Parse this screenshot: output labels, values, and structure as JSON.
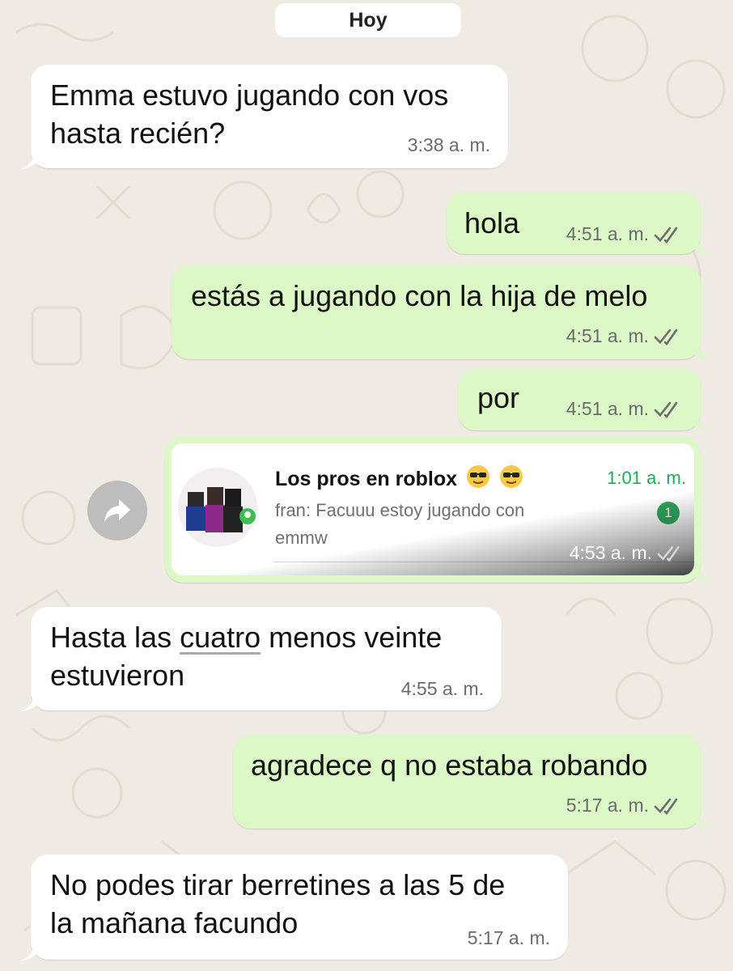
{
  "date_separator": "Hoy",
  "messages": [
    {
      "text": "Emma estuvo jugando con vos\nhasta recién?",
      "time": "3:38 a. m."
    },
    {
      "text": "hola",
      "time": "4:51 a. m."
    },
    {
      "text": "estás a jugando con la hija de melo",
      "time": "4:51 a. m."
    },
    {
      "text": "por",
      "time": "4:51 a. m."
    },
    {
      "text_before": "Hasta las ",
      "text_underlined": "cuatro",
      "text_after": " menos veinte\nestuvieron",
      "time": "4:55 a. m."
    },
    {
      "text": "agradece q no estaba robando",
      "time": "5:17 a. m."
    },
    {
      "text": "No podes tirar berretines a las 5 de\nla mañana facundo",
      "time": "5:17 a. m."
    }
  ],
  "shared_screenshot": {
    "chat_name": "Los pros en roblox",
    "chat_time": "1:01 a. m.",
    "preview_sender": "fran:",
    "preview_text": "Facuuu estoy jugando con emmw",
    "unread_count": "1",
    "message_time": "4:53 a. m."
  },
  "icons": {
    "forward": "forward-arrow-icon",
    "read_receipt": "double-check-icon",
    "emoji": "sunglasses-emoji-icon",
    "avatar": "roblox-group-avatar"
  },
  "colors": {
    "incoming": "#ffffff",
    "outgoing": "#dcf8c6",
    "background": "#efeae2",
    "unread_badge": "#25a455",
    "chat_time": "#1faa53"
  }
}
